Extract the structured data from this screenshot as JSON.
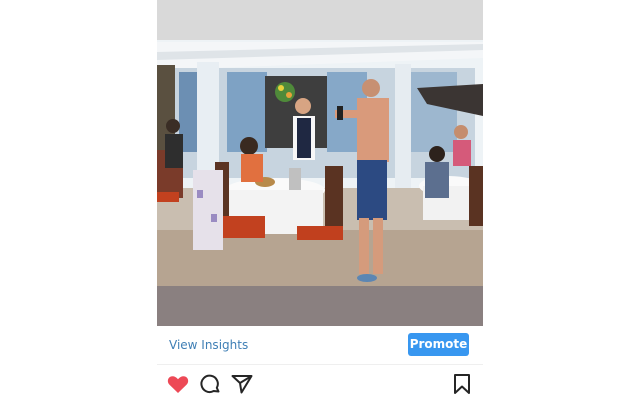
{
  "post": {
    "photo_alt": "",
    "insights_label": "View Insights",
    "promote_label": "Promote"
  },
  "actions": {
    "like_icon": "heart-filled-icon",
    "comment_icon": "comment-icon",
    "share_icon": "paper-plane-icon",
    "save_icon": "bookmark-icon"
  },
  "colors": {
    "like": "#ed4956",
    "link": "#3f7fb5",
    "promote": "#3897f0",
    "icon": "#262626"
  }
}
